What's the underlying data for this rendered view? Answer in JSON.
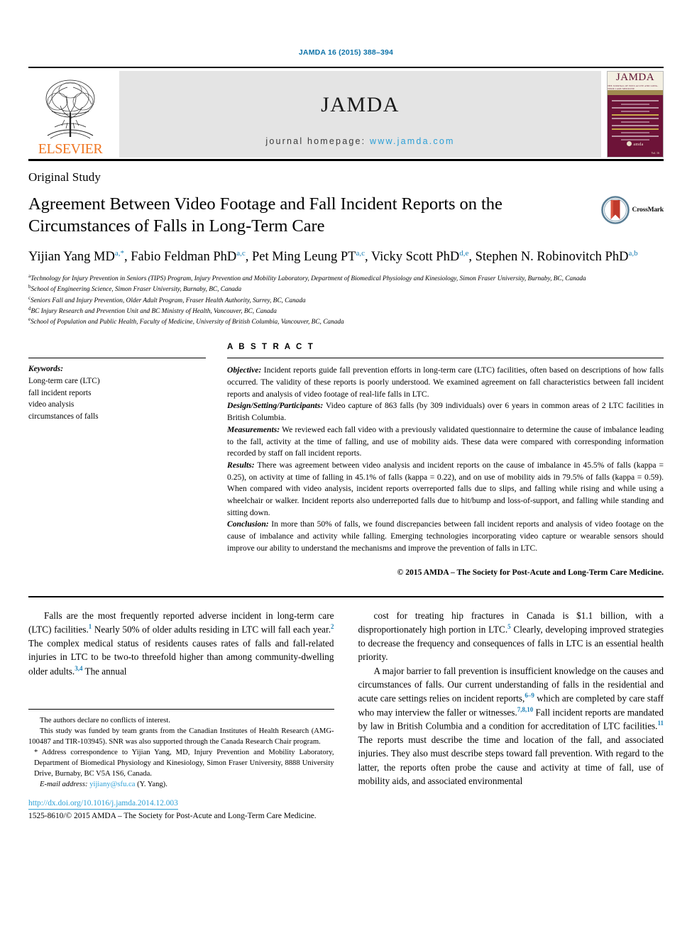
{
  "running_head": "JAMDA 16 (2015) 388–394",
  "masthead": {
    "publisher": "ELSEVIER",
    "journal_title": "JAMDA",
    "homepage_label": "journal homepage:",
    "homepage_url": "www.jamda.com",
    "cover_title": "JAMDA",
    "cover_subtitle": "THE JOURNAL OF POST-ACUTE AND LONG-TERM CARE MEDICINE",
    "cover_logo_text": "amda",
    "cover_logo_sub": "the society for post-acute and long-term care medicine",
    "cover_foot": "Vol. 16",
    "accent_color": "#2b9fd6",
    "elsevier_color": "#ef7622",
    "cover_color": "#6d1338"
  },
  "article": {
    "type": "Original Study",
    "title": "Agreement Between Video Footage and Fall Incident Reports on the Circumstances of Falls in Long-Term Care",
    "crossmark_label": "CrossMark",
    "authors": [
      {
        "name": "Yijian Yang MD",
        "sup": "a,*"
      },
      {
        "name": "Fabio Feldman PhD",
        "sup": "a,c"
      },
      {
        "name": "Pet Ming Leung PT",
        "sup": "a,c"
      },
      {
        "name": "Vicky Scott PhD",
        "sup": "d,e"
      },
      {
        "name": "Stephen N. Robinovitch PhD",
        "sup": "a,b"
      }
    ],
    "affiliations": [
      {
        "marker": "a",
        "text": "Technology for Injury Prevention in Seniors (TIPS) Program, Injury Prevention and Mobility Laboratory, Department of Biomedical Physiology and Kinesiology, Simon Fraser University, Burnaby, BC, Canada"
      },
      {
        "marker": "b",
        "text": "School of Engineering Science, Simon Fraser University, Burnaby, BC, Canada"
      },
      {
        "marker": "c",
        "text": "Seniors Fall and Injury Prevention, Older Adult Program, Fraser Health Authority, Surrey, BC, Canada"
      },
      {
        "marker": "d",
        "text": "BC Injury Research and Prevention Unit and BC Ministry of Health, Vancouver, BC, Canada"
      },
      {
        "marker": "e",
        "text": "School of Population and Public Health, Faculty of Medicine, University of British Columbia, Vancouver, BC, Canada"
      }
    ]
  },
  "keywords": {
    "heading": "Keywords:",
    "items": [
      "Long-term care (LTC)",
      "fall incident reports",
      "video analysis",
      "circumstances of falls"
    ]
  },
  "abstract": {
    "heading": "A B S T R A C T",
    "sections": [
      {
        "lead": "Objective:",
        "text": " Incident reports guide fall prevention efforts in long-term care (LTC) facilities, often based on descriptions of how falls occurred. The validity of these reports is poorly understood. We examined agreement on fall characteristics between fall incident reports and analysis of video footage of real-life falls in LTC."
      },
      {
        "lead": "Design/Setting/Participants:",
        "text": " Video capture of 863 falls (by 309 individuals) over 6 years in common areas of 2 LTC facilities in British Columbia."
      },
      {
        "lead": "Measurements:",
        "text": " We reviewed each fall video with a previously validated questionnaire to determine the cause of imbalance leading to the fall, activity at the time of falling, and use of mobility aids. These data were compared with corresponding information recorded by staff on fall incident reports."
      },
      {
        "lead": "Results:",
        "text": " There was agreement between video analysis and incident reports on the cause of imbalance in 45.5% of falls (kappa = 0.25), on activity at time of falling in 45.1% of falls (kappa = 0.22), and on use of mobility aids in 79.5% of falls (kappa = 0.59). When compared with video analysis, incident reports overreported falls due to slips, and falling while rising and while using a wheelchair or walker. Incident reports also underreported falls due to hit/bump and loss-of-support, and falling while standing and sitting down."
      },
      {
        "lead": "Conclusion:",
        "text": " In more than 50% of falls, we found discrepancies between fall incident reports and analysis of video footage on the cause of imbalance and activity while falling. Emerging technologies incorporating video capture or wearable sensors should improve our ability to understand the mechanisms and improve the prevention of falls in LTC."
      }
    ],
    "copyright": "© 2015 AMDA – The Society for Post-Acute and Long-Term Care Medicine."
  },
  "body": {
    "left_paragraphs": [
      {
        "runs": [
          {
            "t": "Falls are the most frequently reported adverse incident in long-term care (LTC) facilities."
          },
          {
            "sup": "1"
          },
          {
            "t": " Nearly 50% of older adults residing in LTC will fall each year."
          },
          {
            "sup": "2"
          },
          {
            "t": " The complex medical status of residents causes rates of falls and fall-related injuries in LTC to be two-to threefold higher than among community-dwelling older adults."
          },
          {
            "sup": "3,4"
          },
          {
            "t": " The annual"
          }
        ]
      }
    ],
    "right_paragraphs": [
      {
        "runs": [
          {
            "t": "cost for treating hip fractures in Canada is $1.1 billion, with a disproportionately high portion in LTC."
          },
          {
            "sup": "5"
          },
          {
            "t": " Clearly, developing improved strategies to decrease the frequency and consequences of falls in LTC is an essential health priority."
          }
        ]
      },
      {
        "runs": [
          {
            "t": "A major barrier to fall prevention is insufficient knowledge on the causes and circumstances of falls. Our current understanding of falls in the residential and acute care settings relies on incident reports,"
          },
          {
            "sup": "6–9"
          },
          {
            "t": " which are completed by care staff who may interview the faller or witnesses."
          },
          {
            "sup": "7,8,10"
          },
          {
            "t": " Fall incident reports are mandated by law in British Columbia and a condition for accreditation of LTC facilities."
          },
          {
            "sup": "11"
          },
          {
            "t": " The reports must describe the time and location of the fall, and associated injuries. They also must describe steps toward fall prevention. With regard to the latter, the reports often probe the cause and activity at time of fall, use of mobility aids, and associated environmental"
          }
        ]
      }
    ]
  },
  "footnotes": {
    "conflict": "The authors declare no conflicts of interest.",
    "funding": "This study was funded by team grants from the Canadian Institutes of Health Research (AMG-100487 and TIR-103945). SNR was also supported through the Canada Research Chair program.",
    "correspondence_marker": "*",
    "correspondence": " Address correspondence to Yijian Yang, MD, Injury Prevention and Mobility Laboratory, Department of Biomedical Physiology and Kinesiology, Simon Fraser University, 8888 University Drive, Burnaby, BC V5A 1S6, Canada.",
    "email_label": "E-mail address:",
    "email": "yijiany@sfu.ca",
    "email_suffix": " (Y. Yang).",
    "doi": "http://dx.doi.org/10.1016/j.jamda.2014.12.003",
    "issn": "1525-8610/© 2015 AMDA – The Society for Post-Acute and Long-Term Care Medicine."
  }
}
